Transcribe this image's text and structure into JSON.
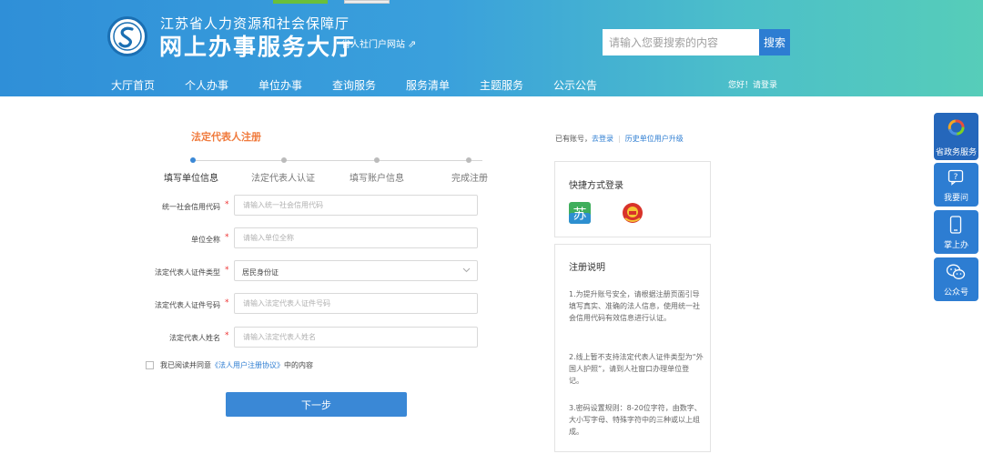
{
  "header": {
    "org_name": "江苏省人力资源和社会保障厅",
    "hall_name": "网上办事服务大厅",
    "portal_link": "省人社门户网站",
    "search": {
      "placeholder": "请输入您要搜索的内容",
      "button": "搜索"
    },
    "nav": [
      "大厅首页",
      "个人办事",
      "单位办事",
      "查询服务",
      "服务清单",
      "主题服务",
      "公示公告"
    ],
    "greeting": "您好！请登录"
  },
  "form": {
    "title": "法定代表人注册",
    "steps": [
      "填写单位信息",
      "法定代表人认证",
      "填写账户信息",
      "完成注册"
    ],
    "active_step": 1,
    "fields": [
      {
        "label": "统一社会信用代码",
        "placeholder": "请输入统一社会信用代码",
        "required": "*"
      },
      {
        "label": "单位全称",
        "placeholder": "请输入单位全称",
        "required": "*"
      },
      {
        "label": "法定代表人证件类型",
        "value": "居民身份证",
        "required": "*"
      },
      {
        "label": "法定代表人证件号码",
        "placeholder": "请输入法定代表人证件号码",
        "required": "*"
      },
      {
        "label": "法定代表人姓名",
        "placeholder": "请输入法定代表人姓名",
        "required": "*"
      }
    ],
    "agree": {
      "prefix": "我已阅读并同意",
      "link": "《法人用户注册协议》",
      "suffix": "中的内容",
      "checked": false
    },
    "next_button": "下一步"
  },
  "right": {
    "account": {
      "prefix": "已有账号，",
      "login": "去登录",
      "upgrade": "历史单位用户升级"
    },
    "quick_login": {
      "title": "快捷方式登录",
      "icons": [
        "su-service-icon",
        "national-emblem-icon"
      ]
    },
    "notes": {
      "title": "注册说明",
      "items": [
        "1.为提升账号安全，请根据注册页面引导填写真实、准确的法人信息，使用统一社会信用代码有效信息进行认证。",
        "2.线上暂不支持法定代表人证件类型为“外国人护照”，请到人社窗口办理单位登记。",
        "3.密码设置规则：8-20位字符，由数字、大小写字母、特殊字符中的三种或以上组成。"
      ]
    }
  },
  "sidebar": [
    "省政务服务",
    "我要问",
    "掌上办",
    "公众号"
  ],
  "colors": {
    "header_start": "#2f8fd8",
    "header_end": "#56cdb9",
    "accent": "#3a88d6",
    "title_orange": "#f07a3c",
    "required": "#e33333"
  }
}
